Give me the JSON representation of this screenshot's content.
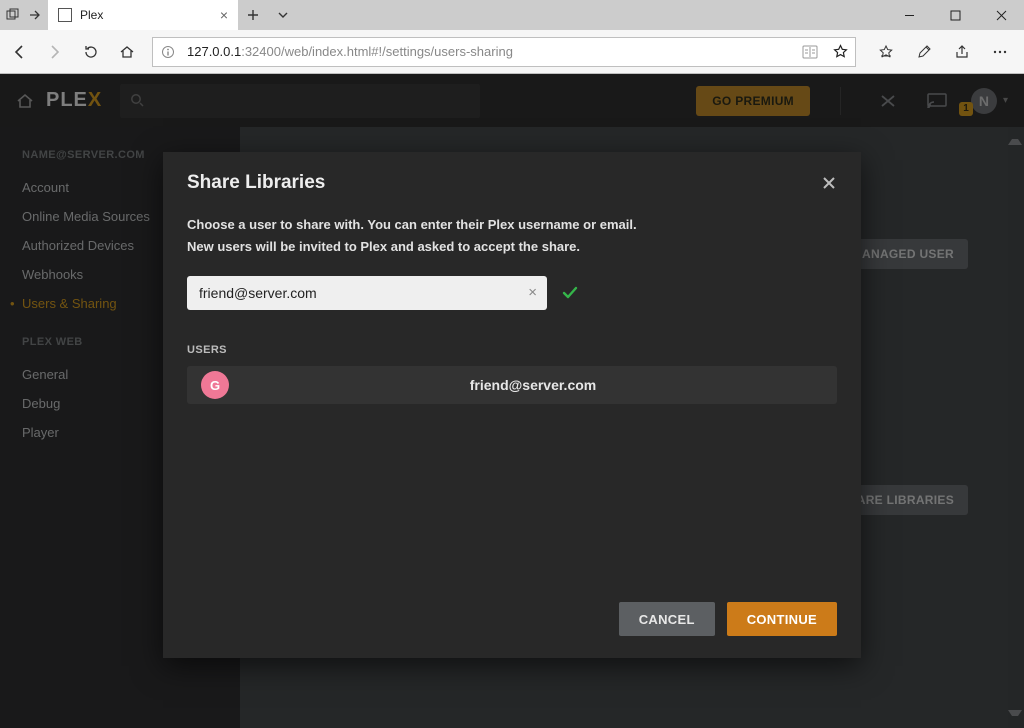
{
  "browser": {
    "tab_title": "Plex",
    "url_host": "127.0.0.1",
    "url_rest": ":32400/web/index.html#!/settings/users-sharing"
  },
  "header": {
    "logo_left": "PLE",
    "logo_right": "X",
    "premium_label": "GO PREMIUM",
    "badge": "1",
    "avatar_letter": "N"
  },
  "sidebar": {
    "section1_title": "NAME@SERVER.COM",
    "items1": {
      "0": "Account",
      "1": "Online Media Sources",
      "2": "Authorized Devices",
      "3": "Webhooks",
      "4": "Users & Sharing"
    },
    "section2_title": "PLEX WEB",
    "items2": {
      "0": "General",
      "1": "Debug",
      "2": "Player"
    }
  },
  "background_buttons": {
    "managed": "MANAGED USER",
    "sharelib": "SHARE LIBRARIES"
  },
  "modal": {
    "title": "Share Libraries",
    "line1": "Choose a user to share with. You can enter their Plex username or email.",
    "line2": "New users will be invited to Plex and asked to accept the share.",
    "input_value": "friend@server.com",
    "users_label": "USERS",
    "user_badge": "G",
    "user_email": "friend@server.com",
    "cancel": "CANCEL",
    "continue": "CONTINUE"
  }
}
